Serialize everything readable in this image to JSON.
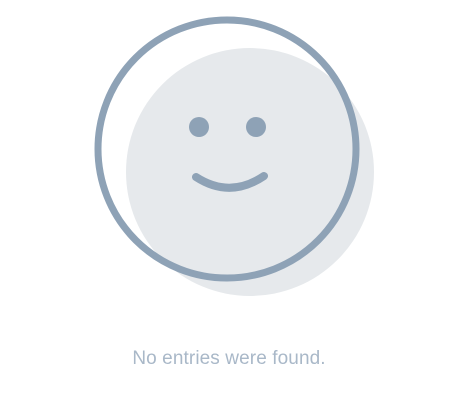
{
  "empty_state": {
    "icon": "smiley-face-icon",
    "message": "No entries were found.",
    "colors": {
      "outline": "#8ea2b6",
      "face_fill": "#e6e9ec",
      "shadow_fill": "#e6e9ec",
      "text": "#a9b8c8"
    }
  }
}
